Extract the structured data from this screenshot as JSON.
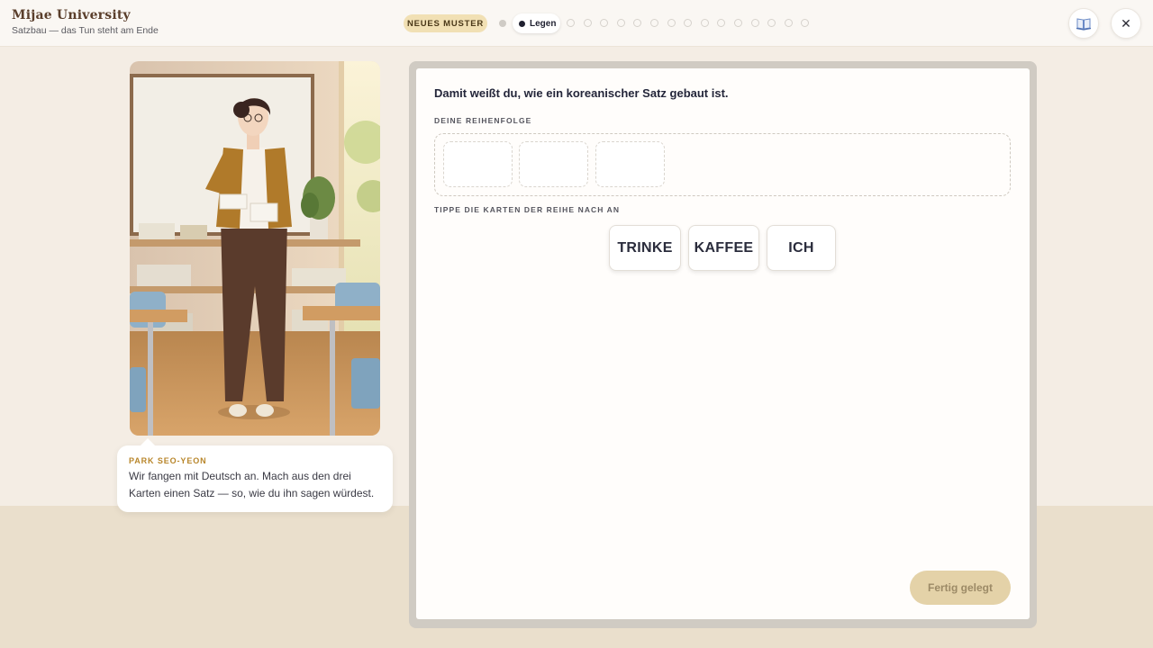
{
  "app": {
    "title": "Mijae University",
    "subtitle": "Satzbau — das Tun steht am Ende"
  },
  "progress": {
    "badge": "NEUES MUSTER",
    "current_step_label": "Legen",
    "completed_steps": 1,
    "remaining_steps": 15
  },
  "toolbar": {
    "book_icon": "book-icon",
    "close_icon": "close-icon",
    "close_glyph": "✕"
  },
  "teacher": {
    "name": "PARK SEO-YEON",
    "message": "Wir fangen mit Deutsch an. Mach aus den drei Karten einen Satz — so, wie du ihn sagen würdest."
  },
  "exercise": {
    "instruction": "Damit weißt du, wie ein koreanischer Satz gebaut ist.",
    "order_label": "DEINE REIHENFOLGE",
    "empty_slots": 3,
    "cards_label": "TIPPE DIE KARTEN DER REIHE NACH AN",
    "cards": [
      {
        "text": "TRINKE"
      },
      {
        "text": "KAFFEE"
      },
      {
        "text": "ICH"
      }
    ],
    "submit_label": "Fertig gelegt"
  },
  "colors": {
    "accent_gold": "#b8862b",
    "badge_bg": "#f1e0b4",
    "button_disabled": "#e4d2a8"
  }
}
